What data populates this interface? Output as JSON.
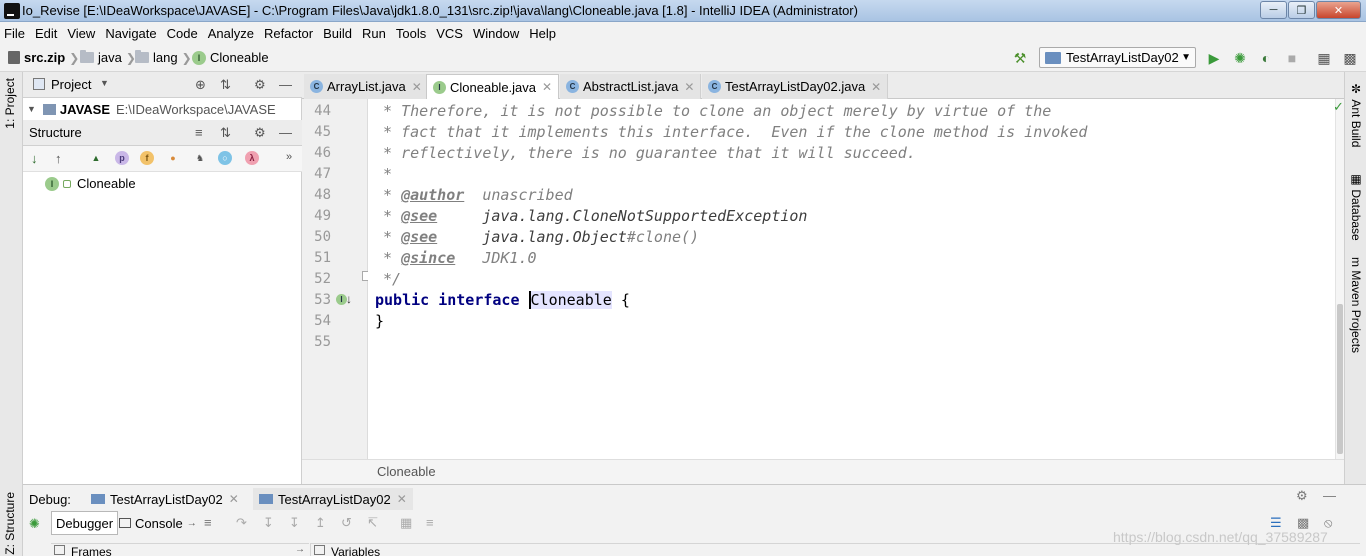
{
  "window": {
    "title": "Io_Revise [E:\\IDeaWorkspace\\JAVASE] - C:\\Program Files\\Java\\jdk1.8.0_131\\src.zip!\\java\\lang\\Cloneable.java [1.8] - IntelliJ IDEA (Administrator)"
  },
  "menu": [
    "File",
    "Edit",
    "View",
    "Navigate",
    "Code",
    "Analyze",
    "Refactor",
    "Build",
    "Run",
    "Tools",
    "VCS",
    "Window",
    "Help"
  ],
  "navbar": {
    "crumbs": [
      "src.zip",
      "java",
      "lang",
      "Cloneable"
    ],
    "run_config": "TestArrayListDay02"
  },
  "left_strip": {
    "project_tab": "1: Project",
    "structure_tab": "Z: Structure"
  },
  "right_strip": {
    "ant": "Ant Build",
    "database": "Database",
    "maven": "Maven Projects"
  },
  "project_panel": {
    "title": "Project",
    "root_name": "JAVASE",
    "root_path": "E:\\IDeaWorkspace\\JAVASE"
  },
  "structure_panel": {
    "title": "Structure",
    "item": "Cloneable"
  },
  "editor": {
    "tabs": [
      {
        "label": "ArrayList.java",
        "kind": "class"
      },
      {
        "label": "Cloneable.java",
        "kind": "interface",
        "active": true
      },
      {
        "label": "AbstractList.java",
        "kind": "class"
      },
      {
        "label": "TestArrayListDay02.java",
        "kind": "class"
      }
    ],
    "line_numbers": [
      "44",
      "45",
      "46",
      "47",
      "48",
      "49",
      "50",
      "51",
      "52",
      "53",
      "54",
      "55"
    ],
    "lines": {
      "l44": "* Therefore, it is not possible to clone an object merely by virtue of the",
      "l45": "* fact that it implements this interface.  Even if the clone method is invoked",
      "l46": "* reflectively, there is no guarantee that it will succeed.",
      "l47": "*",
      "l48_star": "* ",
      "l48_tag": "@author",
      "l48_text": "  unascribed",
      "l49_star": "* ",
      "l49_tag": "@see",
      "l49_text": "     java.lang.CloneNotSupportedException",
      "l50_star": "* ",
      "l50_tag": "@see",
      "l50_text_a": "     java.lang.Object",
      "l50_text_b": "#clone()",
      "l51_star": "* ",
      "l51_tag": "@since",
      "l51_text": "   JDK1.0",
      "l52": "*/",
      "l53_public": "public",
      "l53_interface": "interface",
      "l53_name": "Cloneable",
      "l53_brace": " {",
      "l54": "}"
    },
    "breadcrumb": "Cloneable"
  },
  "debug": {
    "label": "Debug:",
    "session_tabs": [
      "TestArrayListDay02",
      "TestArrayListDay02"
    ],
    "subtabs": [
      "Debugger",
      "Console"
    ],
    "frames_label": "Frames",
    "variables_label": "Variables"
  },
  "watermark": "https://blog.csdn.net/qq_37589287"
}
